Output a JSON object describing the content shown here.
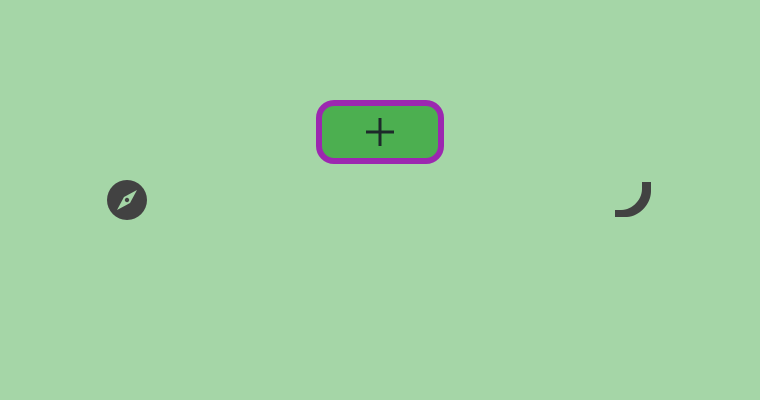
{
  "colors": {
    "background": "#a5d6a7",
    "add_button_fill": "#4caf50",
    "add_button_border": "#9c27b0",
    "icon_color": "#424242"
  },
  "icons": {
    "add": "plus-icon",
    "left": "compass-icon",
    "right": "phone-icon"
  }
}
